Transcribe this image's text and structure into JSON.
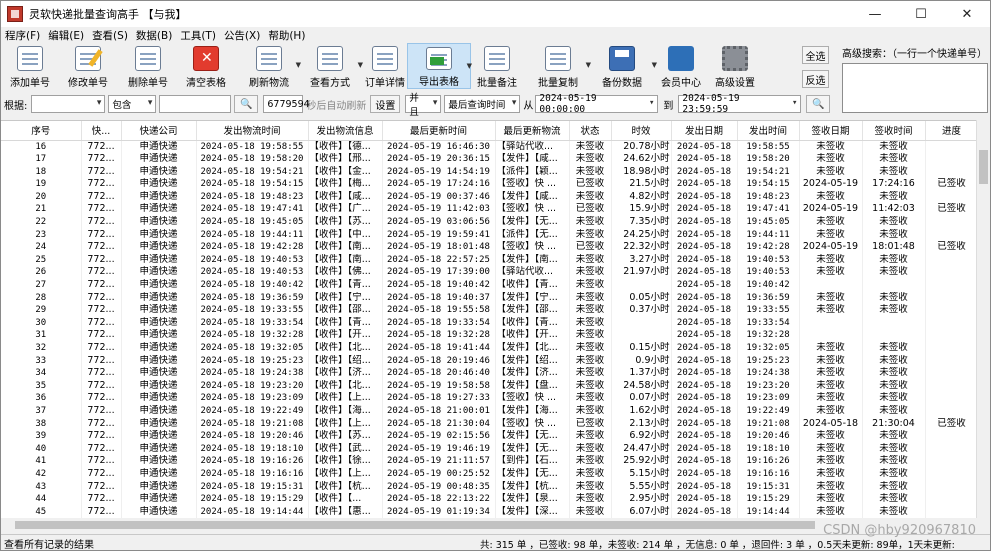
{
  "window": {
    "title": "灵软快递批量查询高手 【与我】"
  },
  "menu": [
    "程序(F)",
    "编辑(E)",
    "查看(S)",
    "数据(B)",
    "工具(T)",
    "公告(X)",
    "帮助(H)"
  ],
  "toolbar": [
    {
      "label": "添加单号",
      "icon": "add-document-icon"
    },
    {
      "label": "修改单号",
      "icon": "edit-pen-icon"
    },
    {
      "label": "删除单号",
      "icon": "delete-document-icon"
    },
    {
      "label": "清空表格",
      "icon": "clear-red-icon"
    },
    {
      "label": "刷新物流",
      "icon": "refresh-list-icon"
    },
    {
      "label": "查看方式",
      "icon": "view-mode-icon"
    },
    {
      "label": "订单详情",
      "icon": "order-detail-icon"
    },
    {
      "label": "导出表格",
      "icon": "export-arrow-icon"
    },
    {
      "label": "批量备注",
      "icon": "batch-note-icon"
    },
    {
      "label": "批量复制",
      "icon": "batch-copy-icon"
    },
    {
      "label": "备份数据",
      "icon": "backup-disk-icon"
    },
    {
      "label": "会员中心",
      "icon": "member-globe-icon"
    },
    {
      "label": "高级设置",
      "icon": "settings-gear-icon"
    }
  ],
  "side": {
    "select_all": "全选",
    "invert": "反选",
    "adv_label": "高级搜索：（一行一个快递单号）"
  },
  "filter": {
    "label": "根据:",
    "field": "",
    "op": "包含",
    "value": "",
    "num": "6779594",
    "auto_refresh": "秒后自动刷新",
    "settings": "设置",
    "and": "并且",
    "time_field": "最后查询时间",
    "from": "从",
    "from_date": "2024-05-19 00:00:00",
    "to": "到",
    "to_date": "2024-05-19 23:59:59"
  },
  "columns": [
    "序号",
    "快...",
    "快递公司",
    "发出物流时间",
    "发出物流信息",
    "最后更新时间",
    "最后更新物流",
    "状态",
    "时效",
    "发出日期",
    "发出时间",
    "签收日期",
    "签收时间",
    "进度"
  ],
  "rows": [
    [
      "16",
      "772...",
      "申通快递",
      "2024-05-18 19:58:55",
      "【收件】【德...",
      "2024-05-19 16:46:30",
      "【驿站代收...",
      "未签收",
      "20.78小时",
      "2024-05-18",
      "19:58:55",
      "未签收",
      "未签收",
      ""
    ],
    [
      "17",
      "772...",
      "申通快递",
      "2024-05-18 19:58:20",
      "【收件】【邢...",
      "2024-05-19 20:36:15",
      "【发件】【咸...",
      "未签收",
      "24.62小时",
      "2024-05-18",
      "19:58:20",
      "未签收",
      "未签收",
      ""
    ],
    [
      "18",
      "772...",
      "申通快递",
      "2024-05-18 19:54:21",
      "【收件】【金...",
      "2024-05-19 14:54:19",
      "【派件】【颖...",
      "未签收",
      "18.98小时",
      "2024-05-18",
      "19:54:21",
      "未签收",
      "未签收",
      ""
    ],
    [
      "19",
      "772...",
      "申通快递",
      "2024-05-18 19:54:15",
      "【收件】【梅...",
      "2024-05-19 17:24:16",
      "【签收】快 ...",
      "已签收",
      "21.5小时",
      "2024-05-18",
      "19:54:15",
      "2024-05-19",
      "17:24:16",
      "已签收"
    ],
    [
      "20",
      "772...",
      "申通快递",
      "2024-05-18 19:48:23",
      "【收件】【咸...",
      "2024-05-19 00:37:46",
      "【发件】【咸...",
      "未签收",
      "4.82小时",
      "2024-05-18",
      "19:48:23",
      "未签收",
      "未签收",
      ""
    ],
    [
      "21",
      "772...",
      "申通快递",
      "2024-05-18 19:47:41",
      "【收件】【广...",
      "2024-05-19 11:42:03",
      "【签收】快 ...",
      "已签收",
      "15.9小时",
      "2024-05-18",
      "19:47:41",
      "2024-05-19",
      "11:42:03",
      "已签收"
    ],
    [
      "22",
      "772...",
      "申通快递",
      "2024-05-18 19:45:05",
      "【收件】【苏...",
      "2024-05-19 03:06:56",
      "【发件】【无...",
      "未签收",
      "7.35小时",
      "2024-05-18",
      "19:45:05",
      "未签收",
      "未签收",
      ""
    ],
    [
      "23",
      "772...",
      "申通快递",
      "2024-05-18 19:44:11",
      "【收件】【中...",
      "2024-05-19 19:59:41",
      "【派件】【无...",
      "未签收",
      "24.25小时",
      "2024-05-18",
      "19:44:11",
      "未签收",
      "未签收",
      ""
    ],
    [
      "24",
      "772...",
      "申通快递",
      "2024-05-18 19:42:28",
      "【收件】【南...",
      "2024-05-19 18:01:48",
      "【签收】快 ...",
      "已签收",
      "22.32小时",
      "2024-05-18",
      "19:42:28",
      "2024-05-19",
      "18:01:48",
      "已签收"
    ],
    [
      "25",
      "772...",
      "申通快递",
      "2024-05-18 19:40:53",
      "【收件】【南...",
      "2024-05-18 22:57:25",
      "【发件】【南...",
      "未签收",
      "3.27小时",
      "2024-05-18",
      "19:40:53",
      "未签收",
      "未签收",
      ""
    ],
    [
      "26",
      "772...",
      "申通快递",
      "2024-05-18 19:40:53",
      "【收件】【佛...",
      "2024-05-19 17:39:00",
      "【驿站代收...",
      "未签收",
      "21.97小时",
      "2024-05-18",
      "19:40:53",
      "未签收",
      "未签收",
      ""
    ],
    [
      "27",
      "772...",
      "申通快递",
      "2024-05-18 19:40:42",
      "【收件】【青...",
      "2024-05-18 19:40:42",
      "【收件】【青...",
      "未签收",
      "",
      "2024-05-18",
      "19:40:42",
      "",
      "",
      ""
    ],
    [
      "28",
      "772...",
      "申通快递",
      "2024-05-18 19:36:59",
      "【收件】【宁...",
      "2024-05-18 19:40:37",
      "【发件】【宁...",
      "未签收",
      "0.05小时",
      "2024-05-18",
      "19:36:59",
      "未签收",
      "未签收",
      ""
    ],
    [
      "29",
      "772...",
      "申通快递",
      "2024-05-18 19:33:55",
      "【收件】【邵...",
      "2024-05-18 19:55:58",
      "【发件】【邵...",
      "未签收",
      "0.37小时",
      "2024-05-18",
      "19:33:55",
      "未签收",
      "未签收",
      ""
    ],
    [
      "30",
      "772...",
      "申通快递",
      "2024-05-18 19:33:54",
      "【收件】【青...",
      "2024-05-18 19:33:54",
      "【收件】【青...",
      "未签收",
      "",
      "2024-05-18",
      "19:33:54",
      "",
      "",
      ""
    ],
    [
      "31",
      "772...",
      "申通快递",
      "2024-05-18 19:32:28",
      "【收件】【开...",
      "2024-05-18 19:32:28",
      "【收件】【开...",
      "未签收",
      "",
      "2024-05-18",
      "19:32:28",
      "",
      "",
      ""
    ],
    [
      "32",
      "772...",
      "申通快递",
      "2024-05-18 19:32:05",
      "【收件】【北...",
      "2024-05-18 19:41:44",
      "【发件】【北...",
      "未签收",
      "0.15小时",
      "2024-05-18",
      "19:32:05",
      "未签收",
      "未签收",
      ""
    ],
    [
      "33",
      "772...",
      "申通快递",
      "2024-05-18 19:25:23",
      "【收件】【绍...",
      "2024-05-18 20:19:46",
      "【发件】【绍...",
      "未签收",
      "0.9小时",
      "2024-05-18",
      "19:25:23",
      "未签收",
      "未签收",
      ""
    ],
    [
      "34",
      "772...",
      "申通快递",
      "2024-05-18 19:24:38",
      "【收件】【济...",
      "2024-05-18 20:46:40",
      "【发件】【济...",
      "未签收",
      "1.37小时",
      "2024-05-18",
      "19:24:38",
      "未签收",
      "未签收",
      ""
    ],
    [
      "35",
      "772...",
      "申通快递",
      "2024-05-18 19:23:20",
      "【收件】【北...",
      "2024-05-19 19:58:58",
      "【发件】【盘...",
      "未签收",
      "24.58小时",
      "2024-05-18",
      "19:23:20",
      "未签收",
      "未签收",
      ""
    ],
    [
      "36",
      "772...",
      "申通快递",
      "2024-05-18 19:23:09",
      "【收件】【上...",
      "2024-05-18 19:27:33",
      "【签收】快 ...",
      "未签收",
      "0.07小时",
      "2024-05-18",
      "19:23:09",
      "未签收",
      "未签收",
      ""
    ],
    [
      "37",
      "772...",
      "申通快递",
      "2024-05-18 19:22:49",
      "【收件】【海...",
      "2024-05-18 21:00:01",
      "【发件】【海...",
      "未签收",
      "1.62小时",
      "2024-05-18",
      "19:22:49",
      "未签收",
      "未签收",
      ""
    ],
    [
      "38",
      "772...",
      "申通快递",
      "2024-05-18 19:21:08",
      "【收件】【上...",
      "2024-05-18 21:30:04",
      "【签收】快 ...",
      "已签收",
      "2.13小时",
      "2024-05-18",
      "19:21:08",
      "2024-05-18",
      "21:30:04",
      "已签收"
    ],
    [
      "39",
      "772...",
      "申通快递",
      "2024-05-18 19:20:46",
      "【收件】【苏...",
      "2024-05-19 02:15:56",
      "【发件】【无...",
      "未签收",
      "6.92小时",
      "2024-05-18",
      "19:20:46",
      "未签收",
      "未签收",
      ""
    ],
    [
      "40",
      "772...",
      "申通快递",
      "2024-05-18 19:18:10",
      "【收件】【武...",
      "2024-05-19 19:46:19",
      "【发件】【无...",
      "未签收",
      "24.47小时",
      "2024-05-18",
      "19:18:10",
      "未签收",
      "未签收",
      ""
    ],
    [
      "41",
      "772...",
      "申通快递",
      "2024-05-18 19:16:26",
      "【收件】【徐...",
      "2024-05-19 21:11:57",
      "【到件】【石...",
      "未签收",
      "25.92小时",
      "2024-05-18",
      "19:16:26",
      "未签收",
      "未签收",
      ""
    ],
    [
      "42",
      "772...",
      "申通快递",
      "2024-05-18 19:16:16",
      "【收件】【上...",
      "2024-05-19 00:25:52",
      "【发件】【无...",
      "未签收",
      "5.15小时",
      "2024-05-18",
      "19:16:16",
      "未签收",
      "未签收",
      ""
    ],
    [
      "43",
      "772...",
      "申通快递",
      "2024-05-18 19:15:31",
      "【收件】【杭...",
      "2024-05-19 00:48:35",
      "【发件】【杭...",
      "未签收",
      "5.55小时",
      "2024-05-18",
      "19:15:31",
      "未签收",
      "未签收",
      ""
    ],
    [
      "44",
      "772...",
      "申通快递",
      "2024-05-18 19:15:29",
      "【收件】【...",
      "2024-05-18 22:13:22",
      "【发件】【泉...",
      "未签收",
      "2.95小时",
      "2024-05-18",
      "19:15:29",
      "未签收",
      "未签收",
      ""
    ],
    [
      "45",
      "772...",
      "申通快递",
      "2024-05-18 19:14:44",
      "【收件】【惠...",
      "2024-05-19 01:19:34",
      "【发件】【深...",
      "未签收",
      "6.07小时",
      "2024-05-18",
      "19:14:44",
      "未签收",
      "未签收",
      ""
    ]
  ],
  "status": {
    "left": "查看所有记录的结果",
    "right": "共: 315 单 ，已签收:  98 单，未签收:  214 单 ，无信息: 0 单 ，退回件: 3 单 ，0.5天未更新: 89单，1天未更新:"
  },
  "watermark": "CSDN @hby920967810",
  "colors": {
    "selected_tool": "#cde4f7",
    "grid_bg": "#ffffff",
    "window_bg": "#f0f0f0"
  }
}
